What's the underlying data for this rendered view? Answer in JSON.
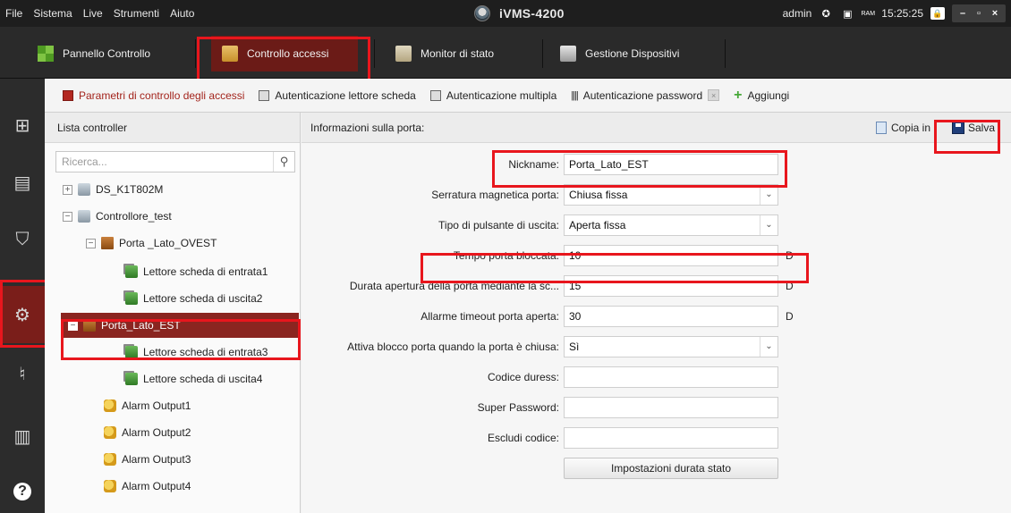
{
  "menu": [
    "File",
    "Sistema",
    "Live",
    "Strumenti",
    "Aiuto"
  ],
  "app": {
    "title": "iVMS-4200"
  },
  "status": {
    "user": "admin",
    "cpu_label": "CPU",
    "ram_label": "RAM",
    "time": "15:25:25"
  },
  "modules": [
    {
      "label": "Pannello Controllo",
      "icon": "control-panel-icon"
    },
    {
      "label": "Controllo accessi",
      "icon": "access-control-icon",
      "active": true
    },
    {
      "label": "Monitor di stato",
      "icon": "status-monitor-icon"
    },
    {
      "label": "Gestione Dispositivi",
      "icon": "device-management-icon"
    }
  ],
  "tabs": [
    {
      "label": "Parametri di controllo degli accessi",
      "active": true
    },
    {
      "label": "Autenticazione lettore scheda"
    },
    {
      "label": "Autenticazione multipla"
    },
    {
      "label": "Autenticazione password"
    },
    {
      "label": "Aggiungi"
    }
  ],
  "list": {
    "header": "Lista controller",
    "search_placeholder": "Ricerca...",
    "nodes": [
      {
        "label": "DS_K1T802M",
        "type": "controller",
        "toggle": "+"
      },
      {
        "label": "Controllore_test",
        "type": "controller",
        "toggle": "−"
      },
      {
        "label": "Porta _Lato_OVEST",
        "type": "door",
        "toggle": "−"
      },
      {
        "label": "Lettore scheda di entrata1",
        "type": "reader"
      },
      {
        "label": "Lettore scheda di uscita2",
        "type": "reader"
      },
      {
        "label": "Porta_Lato_EST",
        "type": "door",
        "toggle": "−",
        "selected": true
      },
      {
        "label": "Lettore scheda di entrata3",
        "type": "reader"
      },
      {
        "label": "Lettore scheda di uscita4",
        "type": "reader"
      },
      {
        "label": "Alarm Output1",
        "type": "alarm"
      },
      {
        "label": "Alarm Output2",
        "type": "alarm"
      },
      {
        "label": "Alarm Output3",
        "type": "alarm"
      },
      {
        "label": "Alarm Output4",
        "type": "alarm"
      }
    ]
  },
  "info": {
    "header": "Informazioni sulla porta:",
    "copy_label": "Copia in",
    "save_label": "Salva",
    "fields": {
      "nickname": {
        "label": "Nickname:",
        "value": "Porta_Lato_EST"
      },
      "magnetic_lock": {
        "label": "Serratura magnetica porta:",
        "value": "Chiusa fissa"
      },
      "exit_button": {
        "label": "Tipo di pulsante di uscita:",
        "value": "Aperta fissa"
      },
      "locked_time": {
        "label": "Tempo porta bloccata:",
        "value": "10",
        "unit": "D"
      },
      "open_duration": {
        "label": "Durata apertura della porta mediante la sc...",
        "value": "15",
        "unit": "D"
      },
      "open_timeout_alarm": {
        "label": "Allarme timeout porta aperta:",
        "value": "30",
        "unit": "D"
      },
      "lock_on_close": {
        "label": "Attiva blocco porta quando la porta è chiusa:",
        "value": "Sì"
      },
      "duress_code": {
        "label": "Codice duress:",
        "value": ""
      },
      "super_password": {
        "label": "Super Password:",
        "value": ""
      },
      "dismiss_code": {
        "label": "Escludi codice:",
        "value": ""
      }
    },
    "state_duration_button": "Impostazioni durata stato"
  },
  "colors": {
    "accent": "#8a2520",
    "highlight": "#e8161d"
  }
}
